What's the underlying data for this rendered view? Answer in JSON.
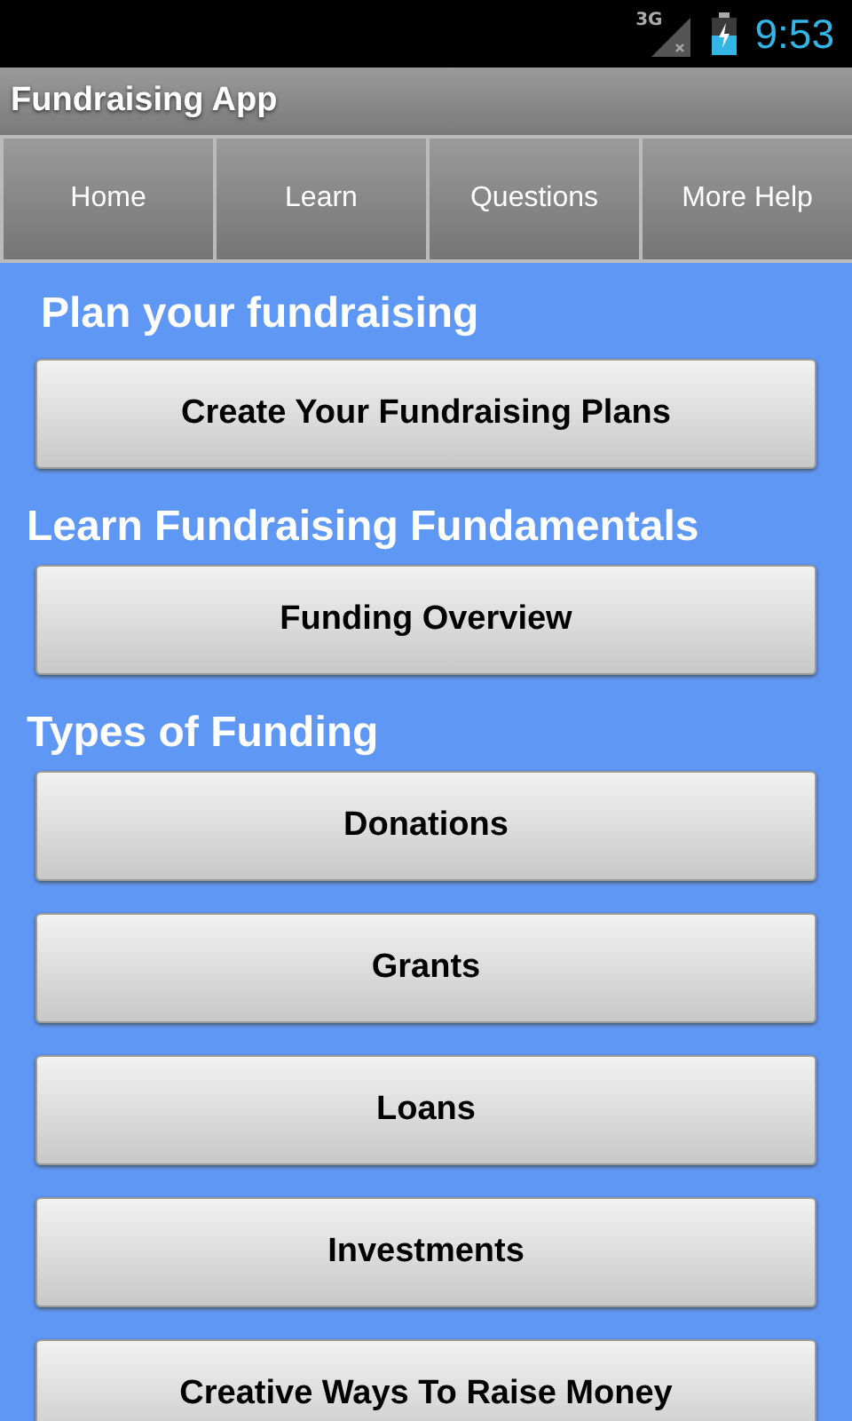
{
  "status_bar": {
    "network": "3G",
    "time": "9:53"
  },
  "title_bar": {
    "title": "Fundraising App"
  },
  "tabs": [
    {
      "label": "Home"
    },
    {
      "label": "Learn"
    },
    {
      "label": "Questions"
    },
    {
      "label": "More Help"
    }
  ],
  "sections": [
    {
      "heading": "Plan your fundraising",
      "buttons": [
        "Create Your Fundraising Plans"
      ]
    },
    {
      "heading": "Learn Fundraising Fundamentals",
      "buttons": [
        "Funding Overview"
      ]
    },
    {
      "heading": "Types of Funding",
      "buttons": [
        "Donations",
        "Grants",
        "Loans",
        "Investments",
        "Creative Ways To Raise Money"
      ]
    }
  ]
}
